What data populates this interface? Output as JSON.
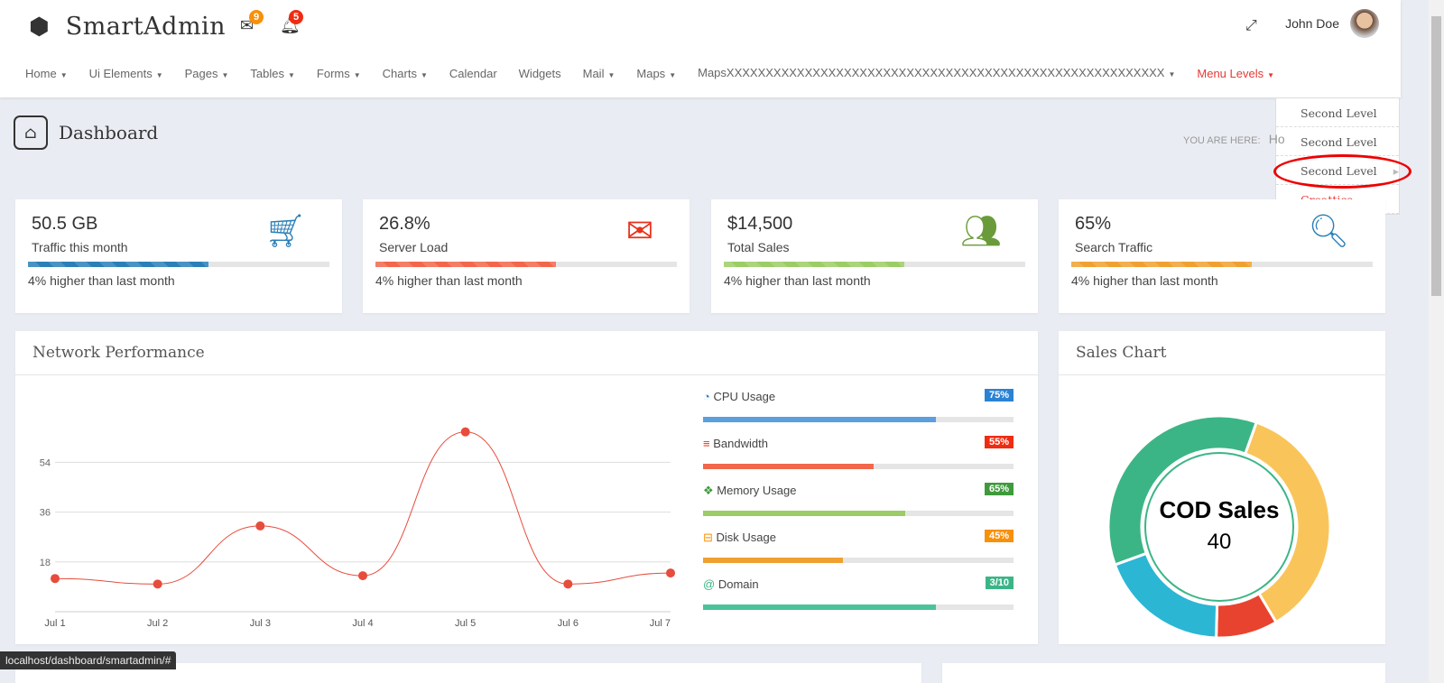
{
  "header": {
    "brand": "SmartAdmin",
    "mail_count": "9",
    "notif_count": "5",
    "user": "John Doe"
  },
  "nav": [
    {
      "label": "Home",
      "caret": true
    },
    {
      "label": "Ui Elements",
      "caret": true
    },
    {
      "label": "Pages",
      "caret": true
    },
    {
      "label": "Tables",
      "caret": true
    },
    {
      "label": "Forms",
      "caret": true
    },
    {
      "label": "Charts",
      "caret": true
    },
    {
      "label": "Calendar",
      "caret": false
    },
    {
      "label": "Widgets",
      "caret": false
    },
    {
      "label": "Mail",
      "caret": true
    },
    {
      "label": "Maps",
      "caret": true
    },
    {
      "label": "MapsXXXXXXXXXXXXXXXXXXXXXXXXXXXXXXXXXXXXXXXXXXXXXXXXXXXXXXXX",
      "caret": true
    },
    {
      "label": "Menu Levels",
      "caret": true,
      "active": true
    }
  ],
  "dropdown": [
    "Second Level",
    "Second Level",
    "Second Level",
    "Creattica"
  ],
  "page": {
    "title": "Dashboard",
    "breadcrumb_label": "YOU ARE HERE:",
    "breadcrumb_first": "Ho"
  },
  "stats": [
    {
      "value": "50.5 GB",
      "label": "Traffic this month",
      "footer": "4% higher than last month",
      "progress": 60,
      "color": "#2a7fb8",
      "icon": "cart-icon"
    },
    {
      "value": "26.8%",
      "label": "Server Load",
      "footer": "4% higher than last month",
      "progress": 60,
      "color": "#f2664b",
      "icon": "envelope-icon"
    },
    {
      "value": "$14,500",
      "label": "Total Sales",
      "footer": "4% higher than last month",
      "progress": 60,
      "color": "#9ccc65",
      "icon": "users-icon"
    },
    {
      "value": "65%",
      "label": "Search Traffic",
      "footer": "4% higher than last month",
      "progress": 60,
      "color": "#f0a030",
      "icon": "search-icon"
    }
  ],
  "network": {
    "title": "Network Performance"
  },
  "chart_data": [
    {
      "type": "line",
      "x": [
        "Jul 1",
        "Jul 2",
        "Jul 3",
        "Jul 4",
        "Jul 5",
        "Jul 6",
        "Jul 7"
      ],
      "values": [
        12,
        10,
        31,
        13,
        65,
        10,
        14
      ],
      "yticks": [
        18,
        36,
        54
      ],
      "ylim": [
        0,
        70
      ],
      "grid": true,
      "color": "#e74c3c"
    },
    {
      "type": "pie",
      "title": "Sales Chart",
      "center_label": "COD Sales",
      "center_value": "40",
      "values": [
        36,
        36,
        9,
        19
      ],
      "colors": [
        "#3cb586",
        "#f9c55a",
        "#e8432e",
        "#2bb6d4"
      ]
    }
  ],
  "resources": [
    {
      "label": "CPU Usage",
      "badge": "75%",
      "progress": 75,
      "color": "#5b9fde",
      "badge_color": "#2a82d4",
      "icon": "dashboard-icon"
    },
    {
      "label": "Bandwidth",
      "badge": "55%",
      "progress": 55,
      "color": "#f2664b",
      "badge_color": "#ef2c12",
      "icon": "database-icon"
    },
    {
      "label": "Memory Usage",
      "badge": "65%",
      "progress": 65,
      "color": "#9ccc65",
      "badge_color": "#3f9a3c",
      "icon": "cubes-icon"
    },
    {
      "label": "Disk Usage",
      "badge": "45%",
      "progress": 45,
      "color": "#f0a030",
      "badge_color": "#f7900a",
      "icon": "hdd-icon"
    },
    {
      "label": "Domain",
      "badge": "3/10",
      "progress": 75,
      "color": "#4cc29a",
      "badge_color": "#3cb586",
      "icon": "at-icon"
    }
  ],
  "sales": {
    "title": "Sales Chart"
  },
  "statusbar": "localhost/dashboard/smartadmin/#"
}
